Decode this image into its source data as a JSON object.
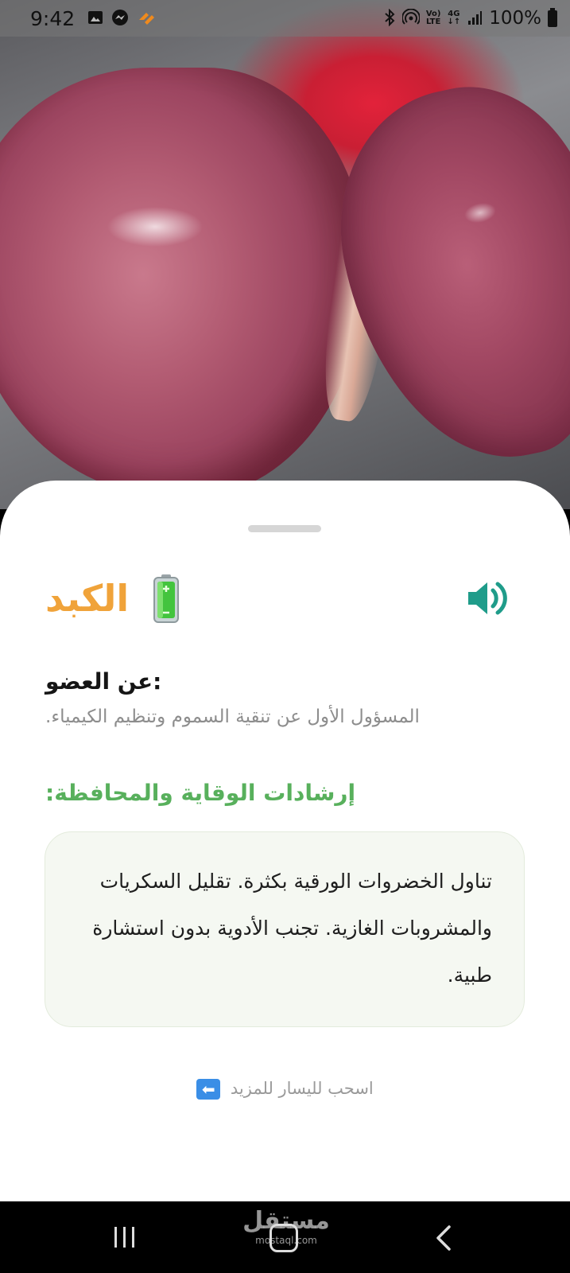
{
  "status_bar": {
    "time": "9:42",
    "network_label_top": "Vo)",
    "network_label_bottom": "LTE",
    "network_4g_top": "4G",
    "network_4g_bottom": "↓↑",
    "battery_percent": "100%"
  },
  "hero": {
    "image_description": "liver-organ-photo"
  },
  "sheet": {
    "organ_name": "الكبد",
    "title_icon": "battery-emoji-icon",
    "speaker_icon": "speaker-volume-icon",
    "about_heading": ":عن العضو",
    "about_text": ".المسؤول الأول عن تنقية السموم وتنظيم الكيمياء",
    "prevention_heading": ":إرشادات الوقاية والمحافظة",
    "tips_text": "تناول الخضروات الورقية بكثرة. تقليل السكريات والمشروبات الغازية. تجنب الأدوية بدون استشارة طبية.",
    "swipe_hint": "اسحب لليسار للمزيد",
    "swipe_arrow": "⬅",
    "accent_title": "#f0a33a",
    "accent_green": "#58b05c",
    "speaker_color": "#1f9c8a"
  },
  "watermark": {
    "arabic": "مستقل",
    "latin": "mostaql.com"
  }
}
